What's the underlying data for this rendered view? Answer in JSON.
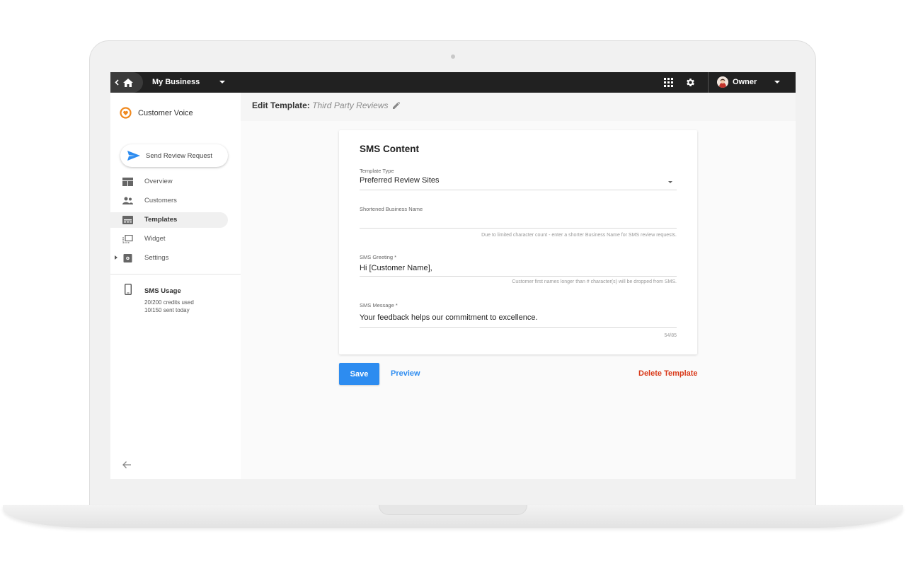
{
  "topbar": {
    "business_name": "My Business",
    "user_name": "Owner"
  },
  "sidebar": {
    "product_title": "Customer Voice",
    "send_button_label": "Send Review Request",
    "items": [
      {
        "label": "Overview",
        "icon": "dashboard-icon"
      },
      {
        "label": "Customers",
        "icon": "people-icon"
      },
      {
        "label": "Templates",
        "icon": "template-icon",
        "active": true
      },
      {
        "label": "Widget",
        "icon": "widget-icon"
      },
      {
        "label": "Settings",
        "icon": "gear-icon"
      }
    ],
    "usage": {
      "title": "SMS Usage",
      "credits": "20/200 credits used",
      "sent": "10/150 sent today"
    }
  },
  "main": {
    "edit_label": "Edit Template:",
    "template_name": "Third Party Reviews",
    "card": {
      "title": "SMS Content",
      "template_type_label": "Template Type",
      "template_type_value": "Preferred Review Sites",
      "short_name_label": "Shortened Business Name",
      "short_name_value": "",
      "short_name_hint": "Due to limited character count - enter a shorter Business Name for SMS review requests.",
      "greeting_label": "SMS Greeting *",
      "greeting_value": "Hi [Customer Name],",
      "greeting_hint": "Customer first names longer than # character(s) will be dropped from SMS.",
      "message_label": "SMS Message *",
      "message_value": "Your feedback helps our commitment to excellence.",
      "message_counter": "54/85"
    },
    "actions": {
      "save": "Save",
      "preview": "Preview",
      "delete": "Delete Template"
    }
  },
  "colors": {
    "topbar": "#212121",
    "primary": "#2d8cf0",
    "danger": "#d93a1a",
    "brand_orange": "#f0891e"
  }
}
